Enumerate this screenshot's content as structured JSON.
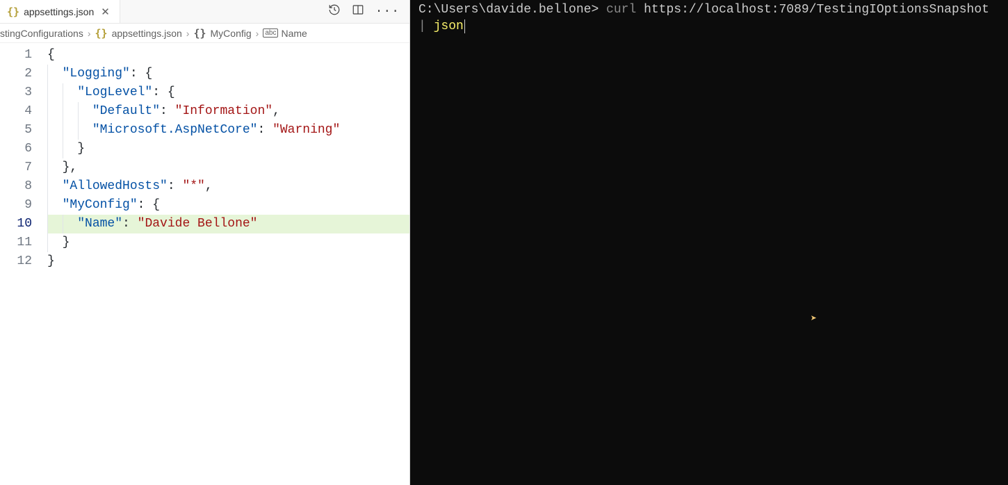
{
  "tab": {
    "filename": "appsettings.json"
  },
  "breadcrumb": {
    "seg0": "stingConfigurations",
    "seg1": "appsettings.json",
    "seg2": "MyConfig",
    "seg3": "Name",
    "sep": "›"
  },
  "lines": [
    "1",
    "2",
    "3",
    "4",
    "5",
    "6",
    "7",
    "8",
    "9",
    "10",
    "11",
    "12"
  ],
  "code": {
    "l1": {
      "t0": "{"
    },
    "l2": {
      "p": "  ",
      "k": "\"Logging\"",
      "c": ": ",
      "b": "{"
    },
    "l3": {
      "p": "    ",
      "k": "\"LogLevel\"",
      "c": ": ",
      "b": "{"
    },
    "l4": {
      "p": "      ",
      "k": "\"Default\"",
      "c": ": ",
      "v": "\"Information\"",
      "e": ","
    },
    "l5": {
      "p": "      ",
      "k": "\"Microsoft.AspNetCore\"",
      "c": ": ",
      "v": "\"Warning\""
    },
    "l6": {
      "p": "    ",
      "b": "}"
    },
    "l7": {
      "p": "  ",
      "b": "}",
      "e": ","
    },
    "l8": {
      "p": "  ",
      "k": "\"AllowedHosts\"",
      "c": ": ",
      "v": "\"*\"",
      "e": ","
    },
    "l9": {
      "p": "  ",
      "k": "\"MyConfig\"",
      "c": ": ",
      "b": "{"
    },
    "l10": {
      "p": "    ",
      "k": "\"Name\"",
      "c": ": ",
      "v": "\"Davide Bellone\""
    },
    "l11": {
      "p": "  ",
      "b": "}"
    },
    "l12": {
      "b": "}"
    }
  },
  "terminal": {
    "prompt": "C:\\Users\\davide.bellone> ",
    "cmd_curl": "curl",
    "cmd_url": " https://localhost:7089/TestingIOptionsSnapshot ",
    "cmd_pipe": "|",
    "cmd_space": " ",
    "cmd_json": "json"
  }
}
